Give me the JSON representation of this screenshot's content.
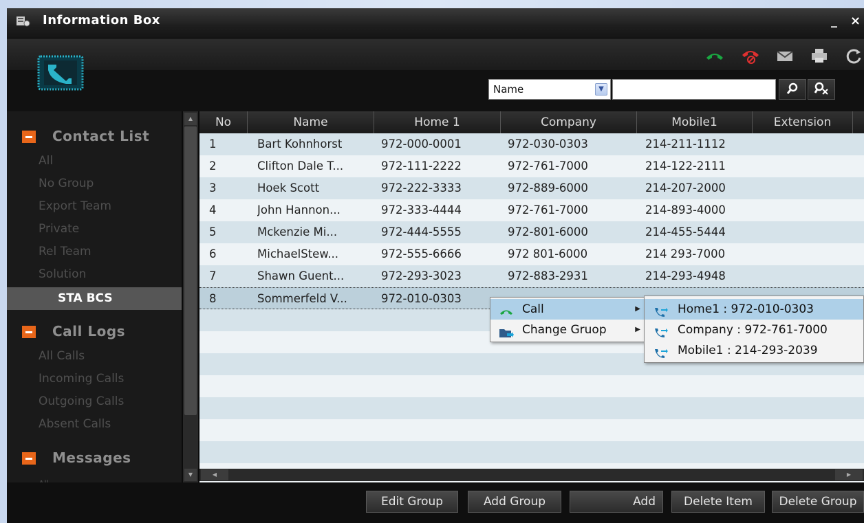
{
  "window": {
    "title": "Information Box",
    "minimize": "_",
    "close": "×"
  },
  "icons": {
    "title": "info-box-icon",
    "logo": "phone-logo-icon",
    "toolbar": [
      "answer-call-icon",
      "hangup-icon",
      "mail-icon",
      "print-icon",
      "refresh-icon"
    ],
    "search": "magnifier-icon",
    "clear_search": "clear-search-icon"
  },
  "colors": {
    "accent": "#e8661a",
    "logo": "#2ab3c9",
    "answer": "#1aa641",
    "hangup": "#e03030"
  },
  "search": {
    "field_select": "Name",
    "value": ""
  },
  "sidebar": {
    "contact_list": {
      "title": "Contact List",
      "items": [
        "All",
        "No Group",
        "Export Team",
        "Private",
        "Rel Team",
        "Solution",
        "STA BCS"
      ],
      "active": "STA BCS"
    },
    "call_logs": {
      "title": "Call Logs",
      "items": [
        "All Calls",
        "Incoming Calls",
        "Outgoing Calls",
        "Absent Calls"
      ]
    },
    "messages": {
      "title": "Messages",
      "items": [
        "All"
      ]
    }
  },
  "table": {
    "columns": [
      "No",
      "Name",
      "Home 1",
      "Company",
      "Mobile1",
      "Extension"
    ],
    "rows": [
      {
        "no": "1",
        "name": "Bart Kohnhorst",
        "home": "972-000-0001",
        "company": "972-030-0303",
        "mobile": "214-211-1112",
        "ext": ""
      },
      {
        "no": "2",
        "name": "Clifton Dale T...",
        "home": "972-111-2222",
        "company": "972-761-7000",
        "mobile": "214-122-2111",
        "ext": ""
      },
      {
        "no": "3",
        "name": "Hoek Scott",
        "home": "972-222-3333",
        "company": "972-889-6000",
        "mobile": "214-207-2000",
        "ext": ""
      },
      {
        "no": "4",
        "name": "John Hannon...",
        "home": "972-333-4444",
        "company": "972-761-7000",
        "mobile": "214-893-4000",
        "ext": ""
      },
      {
        "no": "5",
        "name": "Mckenzie Mi...",
        "home": "972-444-5555",
        "company": "972-801-6000",
        "mobile": "214-455-5444",
        "ext": ""
      },
      {
        "no": "6",
        "name": "MichaelStew...",
        "home": "972-555-6666",
        "company": "972 801-6000",
        "mobile": "214 293-7000",
        "ext": ""
      },
      {
        "no": "7",
        "name": "Shawn Guent...",
        "home": "972-293-3023",
        "company": "972-883-2931",
        "mobile": "214-293-4948",
        "ext": ""
      },
      {
        "no": "8",
        "name": "Sommerfeld V...",
        "home": "972-010-0303",
        "company": "",
        "mobile": "",
        "ext": ""
      }
    ],
    "selected_row": "8"
  },
  "context_menu": {
    "items": [
      "Call",
      "Change Gruop"
    ],
    "highlighted": "Call",
    "submenu": [
      "Home1 : 972-010-0303",
      "Company : 972-761-7000",
      "Mobile1 : 214-293-2039"
    ]
  },
  "footer": {
    "buttons": [
      "Edit Group",
      "Add Group",
      "Add",
      "Delete Item",
      "Delete Group"
    ]
  }
}
